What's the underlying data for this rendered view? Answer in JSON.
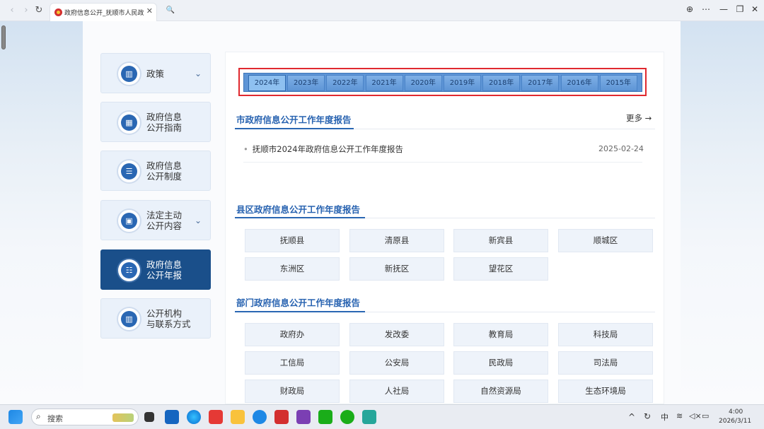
{
  "browser": {
    "tab_title": "政府信息公开_抚顺市人民政府",
    "tab_close": "✕",
    "nav_back": "‹",
    "nav_forward": "›",
    "reload": "↻",
    "search_tab": "🔍",
    "win_minimize": "—",
    "win_restore": "❐",
    "win_close": "✕",
    "more": "⋯",
    "globe": "⊕"
  },
  "sidebar": {
    "items": [
      {
        "label": "政策",
        "icon": "book-icon",
        "glyph": "▥",
        "chevron": true
      },
      {
        "label": "政府信息\n公开指南",
        "icon": "building-icon",
        "glyph": "▦",
        "chevron": false
      },
      {
        "label": "政府信息\n公开制度",
        "icon": "document-icon",
        "glyph": "☰",
        "chevron": false
      },
      {
        "label": "法定主动\n公开内容",
        "icon": "calendar-icon",
        "glyph": "▣",
        "chevron": true
      },
      {
        "label": "政府信息\n公开年报",
        "icon": "list-icon",
        "glyph": "☷",
        "chevron": false,
        "active": true
      },
      {
        "label": "公开机构\n与联系方式",
        "icon": "book-icon",
        "glyph": "▥",
        "chevron": false
      }
    ],
    "chevron_glyph": "⌄"
  },
  "years": [
    "2024年",
    "2023年",
    "2022年",
    "2021年",
    "2020年",
    "2019年",
    "2018年",
    "2017年",
    "2016年",
    "2015年"
  ],
  "sections": {
    "city": {
      "title": "市政府信息公开工作年度报告",
      "more": "更多 →",
      "items": [
        {
          "title": "抚顺市2024年政府信息公开工作年度报告",
          "date": "2025-02-24"
        }
      ]
    },
    "county": {
      "title": "县区政府信息公开工作年度报告",
      "items": [
        "抚顺县",
        "清原县",
        "新宾县",
        "顺城区",
        "东洲区",
        "新抚区",
        "望花区"
      ]
    },
    "dept": {
      "title": "部门政府信息公开工作年度报告",
      "items": [
        "政府办",
        "发改委",
        "教育局",
        "科技局",
        "工信局",
        "公安局",
        "民政局",
        "司法局",
        "财政局",
        "人社局",
        "自然资源局",
        "生态环境局"
      ]
    }
  },
  "taskbar": {
    "search_placeholder": "搜索",
    "ime": "中",
    "time": "4:00",
    "date": "2026/3/11"
  },
  "colors": {
    "accent": "#2762b0",
    "active_side": "#1a4f8a",
    "highlight_frame": "#e0292f"
  }
}
